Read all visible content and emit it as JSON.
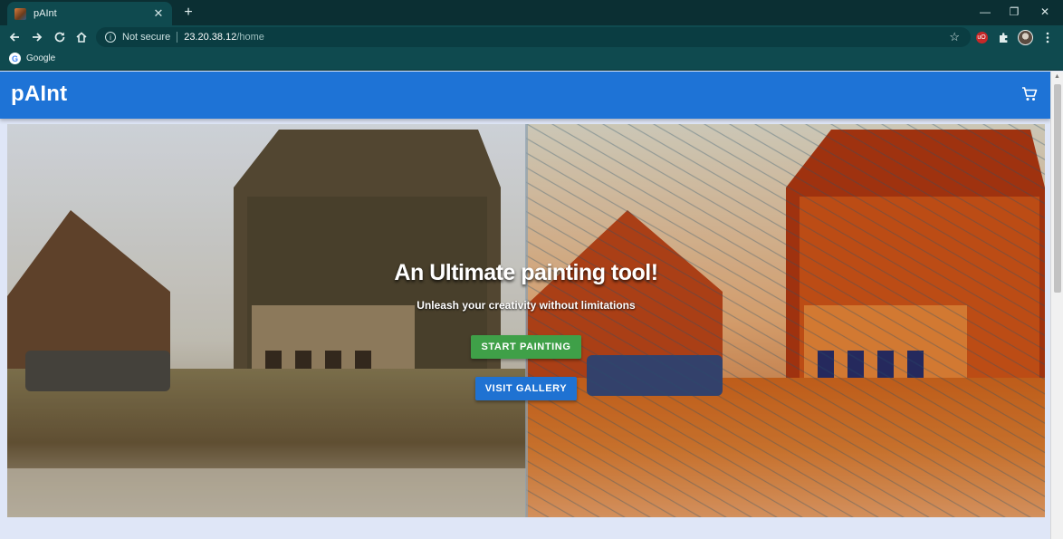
{
  "browser": {
    "tab_title": "pAInt",
    "tab_close_glyph": "✕",
    "newtab_glyph": "+",
    "security_label": "Not secure",
    "url_host": "23.20.38.12",
    "url_path": "/home",
    "bookmark_label": "Google",
    "extension_badge": "uO",
    "window_controls": {
      "minimize": "—",
      "maximize": "❐",
      "close": "✕"
    }
  },
  "app": {
    "brand": "pAInt",
    "cart_icon": "shopping-cart-icon"
  },
  "hero": {
    "title": "An Ultimate painting tool!",
    "subtitle": "Unleash your creativity without limitations",
    "primary_button": "START PAINTING",
    "secondary_button": "VISIT GALLERY"
  },
  "colors": {
    "app_bar": "#1e73d6",
    "start_button": "#3fa048",
    "gallery_button": "#1f72d2",
    "browser_chrome": "#0f4a4f"
  }
}
